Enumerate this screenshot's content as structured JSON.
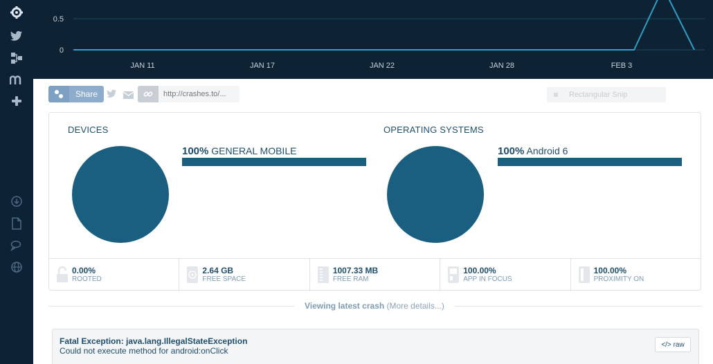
{
  "sidebar": {
    "icons": [
      "logo-gear-icon",
      "twitter-icon",
      "network-icon",
      "medium-icon",
      "plus-icon",
      "download-icon",
      "document-icon",
      "chat-icon",
      "globe-icon"
    ]
  },
  "chart_data": {
    "type": "line",
    "y_ticks": [
      "0.5",
      "0"
    ],
    "x_ticks": [
      "JAN 11",
      "JAN 17",
      "JAN 22",
      "JAN 28",
      "FEB 3"
    ],
    "series": [
      {
        "x": [
          "Jan 6",
          "Jan 11",
          "Jan 17",
          "Jan 22",
          "Jan 28",
          "Feb 3",
          "Feb 4",
          "Feb 5",
          "Feb 6"
        ],
        "y": [
          0,
          0,
          0,
          0,
          0,
          0,
          0,
          1,
          0
        ]
      }
    ],
    "colors": {
      "line": "#2f9fc6",
      "background": "#0d2233",
      "grid": "#1f4560"
    }
  },
  "sharebar": {
    "share_label": "Share",
    "link_placeholder": "http://crashes.to/...",
    "snip_label": "Rectangular Snip"
  },
  "devices": {
    "title": "DEVICES",
    "percent": "100%",
    "name": "GENERAL MOBILE"
  },
  "os": {
    "title": "OPERATING SYSTEMS",
    "percent": "100%",
    "name": "Android 6"
  },
  "stats": [
    {
      "value": "0.00%",
      "label": "ROOTED",
      "icon": "unlock-icon"
    },
    {
      "value": "2.64 GB",
      "label": "FREE SPACE",
      "icon": "disk-icon"
    },
    {
      "value": "1007.33 MB",
      "label": "FREE RAM",
      "icon": "ram-icon"
    },
    {
      "value": "100.00%",
      "label": "APP IN FOCUS",
      "icon": "focus-icon"
    },
    {
      "value": "100.00%",
      "label": "PROXIMITY ON",
      "icon": "proximity-icon"
    }
  ],
  "crash_header": {
    "viewing": "Viewing latest crash",
    "more": "(More details...)"
  },
  "crash": {
    "title": "Fatal Exception: java.lang.IllegalStateException",
    "message": "Could not execute method for android:onClick",
    "raw_label": "raw"
  },
  "colors": {
    "accent": "#1a5f80",
    "sidebar": "#0e2235",
    "text": "#1f4e6d",
    "muted": "#7d9bb3"
  }
}
